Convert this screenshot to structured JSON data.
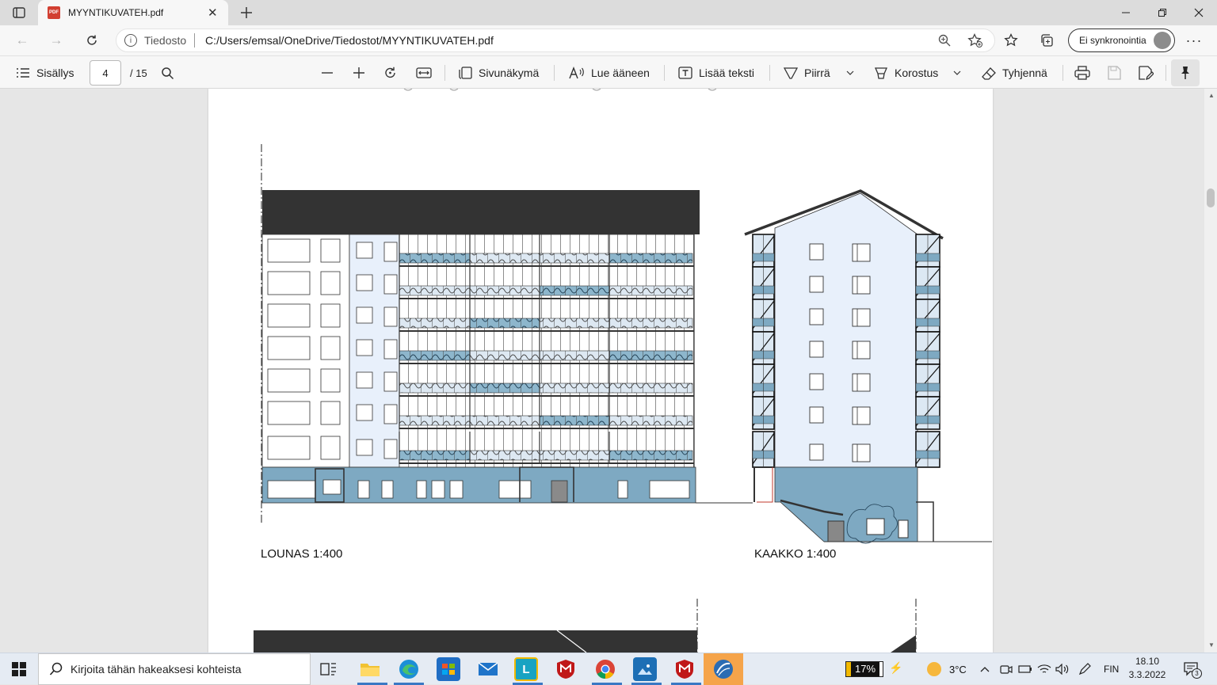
{
  "browser": {
    "tab_title": "MYYNTIKUVATEH.pdf",
    "tab_icon_text": "PDF",
    "address_label": "Tiedosto",
    "url": "C:/Users/emsal/OneDrive/Tiedostot/MYYNTIKUVATEH.pdf",
    "sync_label": "Ei synkronointia"
  },
  "pdf_toolbar": {
    "contents_label": "Sisällys",
    "page_number": "4",
    "page_total": "/ 15",
    "page_view_label": "Sivunäkymä",
    "read_aloud_label": "Lue ääneen",
    "add_text_label": "Lisää teksti",
    "draw_label": "Piirrä",
    "highlight_label": "Korostus",
    "erase_label": "Tyhjennä"
  },
  "drawing": {
    "label_left": "LOUNAS 1:400",
    "label_right": "KAAKKO 1:400"
  },
  "taskbar": {
    "search_placeholder": "Kirjoita tähän hakeaksesi kohteista",
    "battery": "17%",
    "temperature": "3°C",
    "language": "FIN",
    "time": "18.10",
    "date": "3.3.2022",
    "notification_count": "3"
  },
  "colors": {
    "facade_blue": "#7ea9c2",
    "base_blue": "#6c9bb8",
    "wall_light": "#e8f0fb",
    "roof_dark": "#333333",
    "accent_edge": "#0c59a4"
  }
}
